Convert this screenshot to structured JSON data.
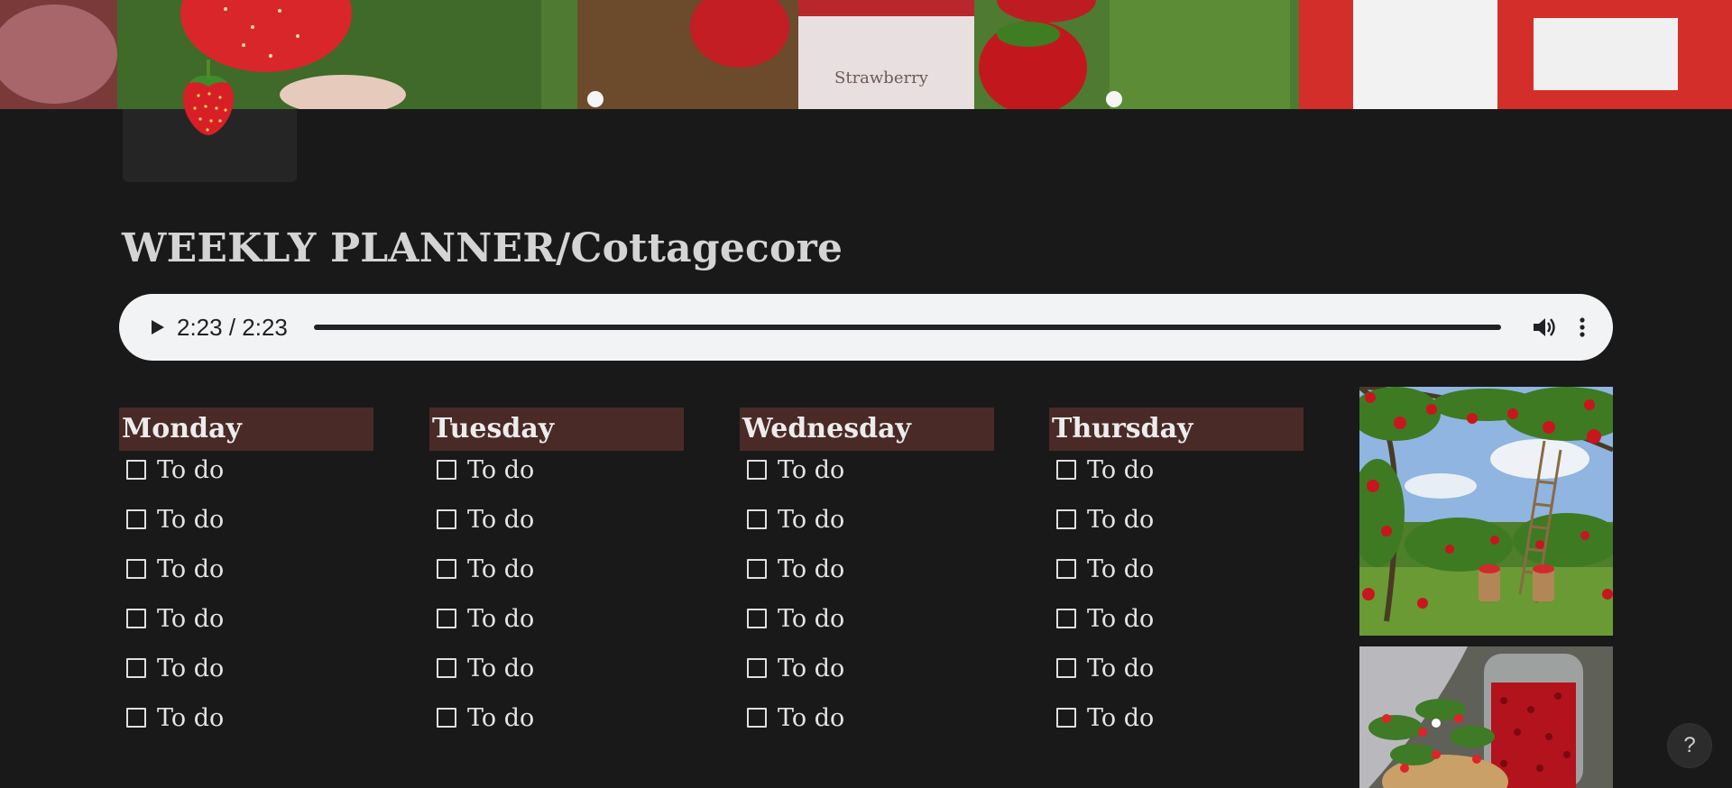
{
  "page": {
    "title": "WEEKLY PLANNER/Cottagecore",
    "icon": "strawberry-icon"
  },
  "audio": {
    "time": "2:23 / 2:23",
    "progress": 1.0
  },
  "days": [
    {
      "label": "Monday",
      "todos": [
        "To do",
        "To do",
        "To do",
        "To do",
        "To do",
        "To do"
      ]
    },
    {
      "label": "Tuesday",
      "todos": [
        "To do",
        "To do",
        "To do",
        "To do",
        "To do",
        "To do"
      ]
    },
    {
      "label": "Wednesday",
      "todos": [
        "To do",
        "To do",
        "To do",
        "To do",
        "To do",
        "To do"
      ]
    },
    {
      "label": "Thursday",
      "todos": [
        "To do",
        "To do",
        "To do",
        "To do",
        "To do",
        "To do"
      ]
    }
  ],
  "help": {
    "label": "?"
  },
  "colors": {
    "background": "#191919",
    "day_header": "#4a2a27",
    "audio_bg": "#f1f3f4"
  }
}
